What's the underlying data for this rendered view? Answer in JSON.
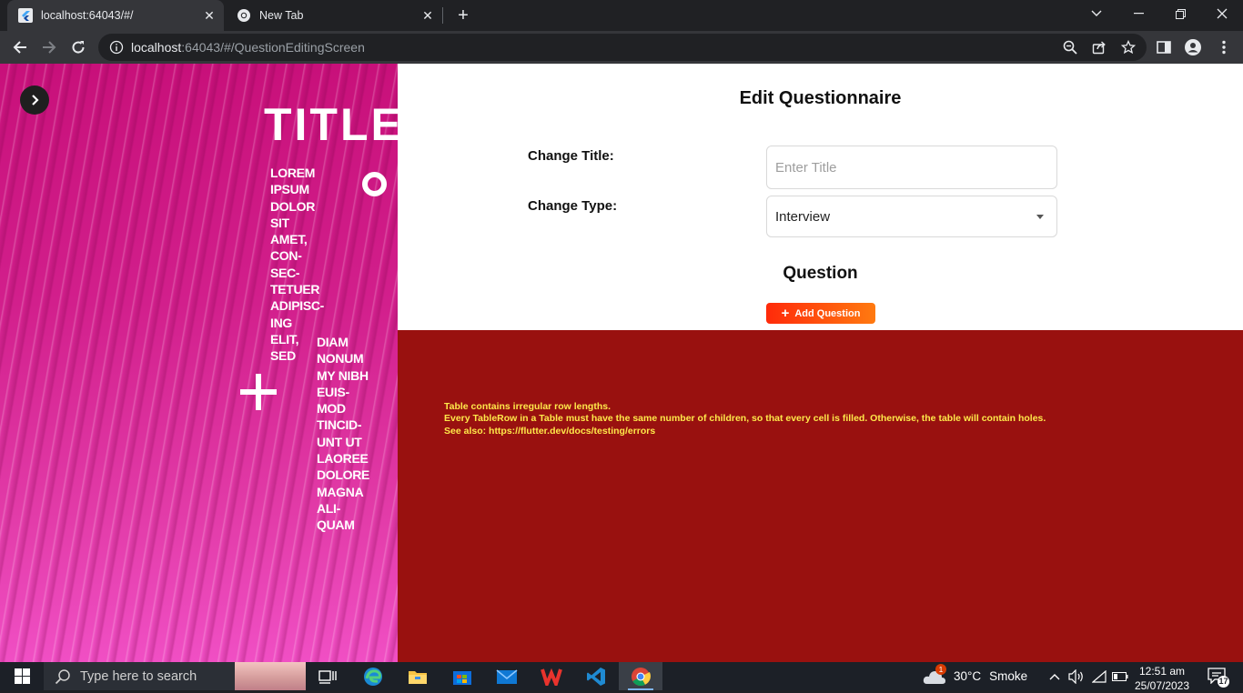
{
  "browser": {
    "tabs": [
      {
        "title": "localhost:64043/#/",
        "active": true
      },
      {
        "title": "New Tab",
        "active": false
      }
    ],
    "url_host": "localhost",
    "url_rest": ":64043/#/QuestionEditingScreen"
  },
  "poster": {
    "title": "TITLE",
    "col1": [
      "LOREM",
      "IPSUM",
      "DOLOR",
      "SIT",
      "AMET,",
      "CON-",
      "SEC-",
      "TETUER",
      "ADIPISC-",
      "ING",
      "ELIT,",
      "SED"
    ],
    "col2": [
      "DIAM",
      "NONUM",
      "MY NIBH",
      "EUIS-",
      "MOD",
      "TINCID-",
      "UNT UT",
      "LAOREE",
      "DOLORE",
      "MAGNA",
      "ALI-",
      "QUAM"
    ]
  },
  "form": {
    "heading": "Edit Questionnaire",
    "title_label": "Change Title:",
    "title_placeholder": "Enter Title",
    "title_value": "",
    "type_label": "Change Type:",
    "type_value": "Interview",
    "question_heading": "Question",
    "add_question_label": "Add Question"
  },
  "error": {
    "lines": [
      "Table contains irregular row lengths.",
      "Every TableRow in a Table must have the same number of children, so that every cell is filled. Otherwise, the table will contain holes.",
      "See also: https://flutter.dev/docs/testing/errors"
    ]
  },
  "taskbar": {
    "search_placeholder": "Type here to search",
    "weather_temp": "30°C",
    "weather_desc": "Smoke",
    "weather_badge": "1",
    "time": "12:51 am",
    "date": "25/07/2023",
    "notification_count": "17"
  },
  "colors": {
    "error_bg": "#99110f",
    "error_text": "#ffe94a",
    "button_gradient_start": "#ff2a0a",
    "button_gradient_end": "#ff7a10"
  }
}
